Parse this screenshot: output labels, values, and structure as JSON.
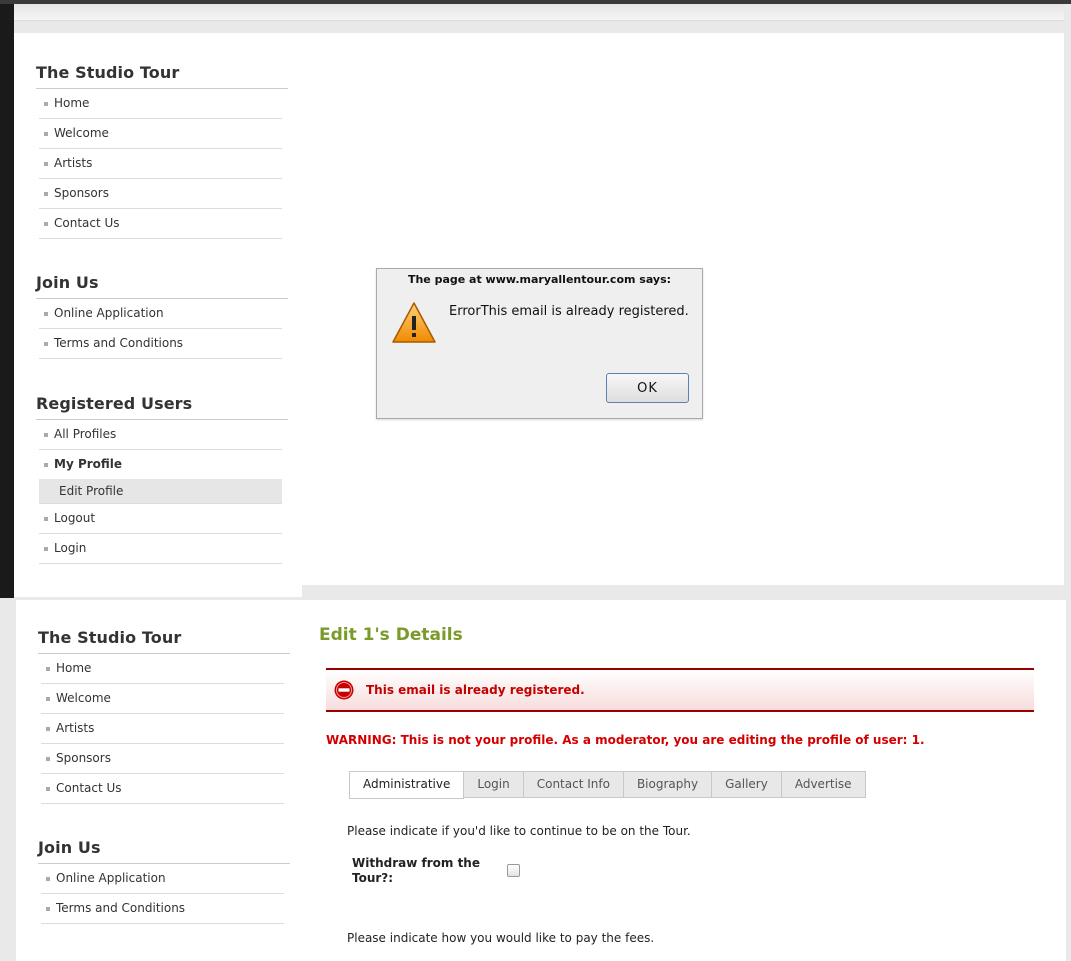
{
  "sidebar1": {
    "sections": [
      {
        "title": "The Studio Tour",
        "items": [
          "Home",
          "Welcome",
          "Artists",
          "Sponsors",
          "Contact Us"
        ]
      },
      {
        "title": "Join Us",
        "items": [
          "Online Application",
          "Terms and Conditions"
        ]
      },
      {
        "title": "Registered Users",
        "items": [
          "All Profiles",
          "My Profile",
          "Edit Profile",
          "Logout",
          "Login"
        ]
      }
    ]
  },
  "dialog": {
    "title": "The page at www.maryallentour.com says:",
    "message": "ErrorThis email is already registered.",
    "ok_label": "OK"
  },
  "sidebar2": {
    "sections": [
      {
        "title": "The Studio Tour",
        "items": [
          "Home",
          "Welcome",
          "Artists",
          "Sponsors",
          "Contact Us"
        ]
      },
      {
        "title": "Join Us",
        "items": [
          "Online Application",
          "Terms and Conditions"
        ]
      }
    ]
  },
  "content": {
    "title": "Edit 1's Details",
    "error": "This email is already registered.",
    "warning": "WARNING: This is not your profile. As a moderator, you are editing the profile of user: 1.",
    "tabs": [
      "Administrative",
      "Login",
      "Contact Info",
      "Biography",
      "Gallery",
      "Advertise"
    ],
    "tour_prompt": "Please indicate if you'd like to continue to be on the Tour.",
    "withdraw_label": "Withdraw from the Tour?:",
    "fees_prompt": "Please indicate how you would like to pay the fees."
  },
  "colors": {
    "accent_green": "#7a9a2a",
    "error_red": "#c40000",
    "error_border": "#990000"
  }
}
